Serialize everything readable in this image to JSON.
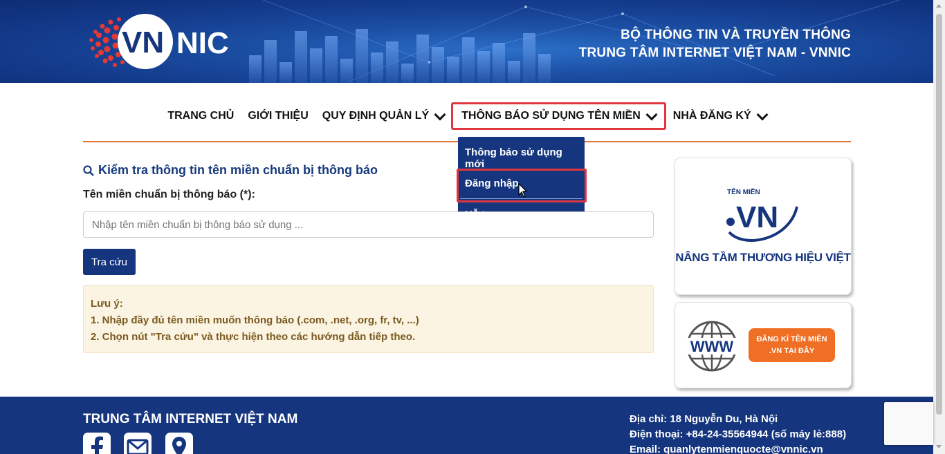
{
  "header": {
    "logo_text": "VNNIC",
    "title_line1": "BỘ THÔNG TIN VÀ TRUYỀN THÔNG",
    "title_line2": "TRUNG TÂM INTERNET VIỆT NAM - VNNIC"
  },
  "nav": {
    "items": [
      {
        "label": "TRANG CHỦ"
      },
      {
        "label": "GIỚI THIỆU"
      },
      {
        "label": "QUY ĐỊNH QUẢN LÝ"
      },
      {
        "label": "THÔNG BÁO SỬ DỤNG TÊN MIỀN"
      },
      {
        "label": "NHÀ ĐĂNG KÝ"
      }
    ],
    "dropdown": [
      {
        "label": "Thông báo sử dụng mới"
      },
      {
        "label": "Đăng nhập"
      },
      {
        "label": "Hỗ trợ"
      }
    ]
  },
  "main": {
    "heading": "Kiểm tra thông tin tên miền chuẩn bị thông báo",
    "field_label": "Tên miền chuẩn bị thông báo (*):",
    "input_placeholder": "Nhập tên miền chuẩn bị thông báo sử dụng ...",
    "search_button": "Tra cứu",
    "note_title": "Lưu ý:",
    "note_lines": [
      "1. Nhập đầy đủ tên miền muốn thông báo (.com, .net, .org, fr, tv, ...)",
      "2. Chọn nút \"Tra cứu\" và thực hiện theo các hướng dẫn tiếp theo."
    ]
  },
  "sidebar": {
    "banner1_small": "TÊN MIỀN",
    "banner1_logo": ".VN",
    "banner1_slogan": "NÂNG TẦM THƯƠNG HIỆU VIỆT",
    "banner2_www": "WWW",
    "banner2_button_line1": "ĐĂNG KÍ TÊN MIỀN",
    "banner2_button_line2": ".VN TẠI ĐÂY"
  },
  "footer": {
    "title": "TRUNG TÂM INTERNET VIỆT NAM",
    "address": "Địa chỉ: 18 Nguyễn Du, Hà Nội",
    "phone": "Điện thoại: +84-24-35564944 (số máy lẻ:888)",
    "email": "Email: quanlytenmienquocte@vnnic.vn"
  },
  "colors": {
    "brand_blue": "#15357e",
    "accent_orange": "#ef6f25",
    "highlight_red": "#e0363f"
  }
}
